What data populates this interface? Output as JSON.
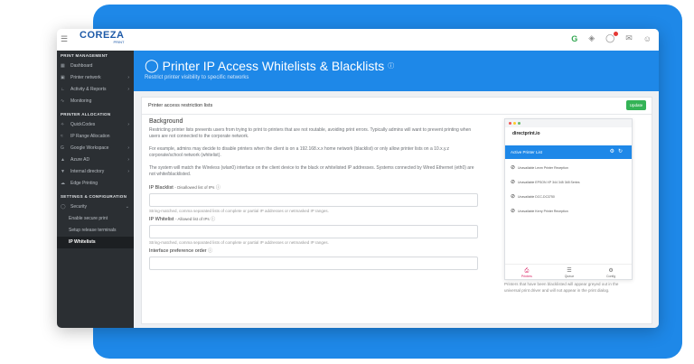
{
  "brand": {
    "name": "COREZA",
    "sub": "PRINT"
  },
  "topbar": {
    "icons": [
      "google-icon",
      "pin-icon",
      "shield-alert-icon",
      "mail-icon",
      "user-icon"
    ]
  },
  "sidebar": {
    "sections": [
      {
        "title": "PRINT MANAGEMENT",
        "items": [
          {
            "label": "Dashboard",
            "icon": "grid-icon",
            "arrow": false
          },
          {
            "label": "Printer network",
            "icon": "printer-icon",
            "arrow": true
          },
          {
            "label": "Activity & Reports",
            "icon": "chart-icon",
            "arrow": true
          },
          {
            "label": "Monitoring",
            "icon": "pulse-icon",
            "arrow": false
          }
        ]
      },
      {
        "title": "PRINTER ALLOCATION",
        "items": [
          {
            "label": "QuickCodes",
            "icon": "star-icon",
            "arrow": true
          },
          {
            "label": "IP Range Allocation",
            "icon": "wifi-icon",
            "arrow": false
          },
          {
            "label": "Google Workspace",
            "icon": "google-icon",
            "arrow": true
          },
          {
            "label": "Azure AD",
            "icon": "azure-icon",
            "arrow": true
          },
          {
            "label": "Internal directory",
            "icon": "filter-icon",
            "arrow": true
          },
          {
            "label": "Edge Printing",
            "icon": "cloud-icon",
            "arrow": false
          }
        ]
      },
      {
        "title": "SETTINGS & CONFIGURATION",
        "items": [
          {
            "label": "Security",
            "icon": "shield-icon",
            "arrow": true
          },
          {
            "label": "Enable secure print",
            "icon": "",
            "arrow": false,
            "sub": true
          },
          {
            "label": "Setup release terminals",
            "icon": "",
            "arrow": false,
            "sub": true
          },
          {
            "label": "IP Whitelists",
            "icon": "",
            "arrow": false,
            "sub": true,
            "active": true
          }
        ]
      }
    ]
  },
  "header": {
    "title": "Printer IP Access Whitelists & Blacklists",
    "subtitle": "Restrict printer visibility to specific networks"
  },
  "card": {
    "title": "Printer access restriction lists",
    "update_label": "Update",
    "background_title": "Background",
    "paragraphs": [
      "Restricting printer lists prevents users from trying to print to printers that are not routable, avoiding print errors. Typically admins will want to prevent printing when users are not connected to the corporate network.",
      "For example, admins may decide to disable printers when the client is on a 192.168.x.x home network (blacklist) or only allow printer lists on a 10.x.y.z corporate/school network (whitelist).",
      "The system will match the Wireless (wlan0) interface on the client device to the black or whitelisted IP addresses. Systems connected by Wired Ethernet (eth0) are not white/blacklisted."
    ],
    "fields": {
      "blacklist_label": "IP Blacklist",
      "blacklist_small": "- Disallowed list of IPs",
      "whitelist_label": "IP Whitelist",
      "whitelist_small": "- Allowed list of IPs",
      "pref_label": "Interface preference order",
      "hint": "String-matched, comma separated lists of complete or partial IP addresses or netmasked IP ranges."
    }
  },
  "phone": {
    "logo": "directprint.io",
    "bar_title": "Active Printer List",
    "printers": [
      "Unavailable Lexm Printer Reception",
      "Unavailable EPSON XP 344 345 348 Series",
      "Unavailable DCC-DC3750",
      "Unavailable Kerry Printer Reception"
    ],
    "nav": [
      "Printers",
      "Queue",
      "Config"
    ],
    "caption": "Printers that have been blacklisted will appear greyed out in the universal print driver and will not appear in the print dialog."
  }
}
